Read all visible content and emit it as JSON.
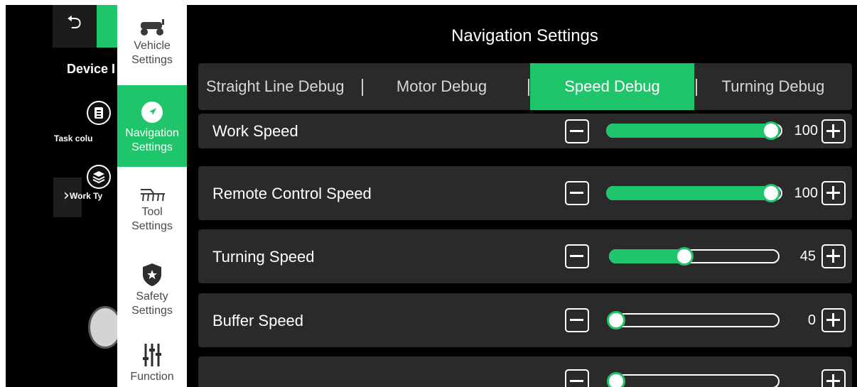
{
  "background_app": {
    "back_icon": "back-arrow-icon",
    "device_title": "Device I",
    "task_label": "Task colu",
    "work_label": "Work Ty",
    "expand_icon": "chevron-right-icon"
  },
  "nav": {
    "items": [
      {
        "label_1": "Vehicle",
        "label_2": "Settings",
        "icon": "tractor-icon",
        "active": false
      },
      {
        "label_1": "Navigation",
        "label_2": "Settings",
        "icon": "navigation-arrow-icon",
        "active": true
      },
      {
        "label_1": "Tool",
        "label_2": "Settings",
        "icon": "harrow-tool-icon",
        "active": false
      },
      {
        "label_1": "Safety",
        "label_2": "Settings",
        "icon": "shield-star-icon",
        "active": false
      },
      {
        "label_1": "Function",
        "label_2": "",
        "icon": "sliders-icon",
        "active": false
      }
    ]
  },
  "main": {
    "title": "Navigation Settings",
    "tabs": [
      {
        "label": "Straight Line Debug",
        "active": false
      },
      {
        "label": "Motor Debug",
        "active": false
      },
      {
        "label": "Speed Debug",
        "active": true
      },
      {
        "label": "Turning Debug",
        "active": false
      }
    ],
    "rows": [
      {
        "label": "Work Speed",
        "value": "100",
        "level": 1.0
      },
      {
        "label": "Remote Control Speed",
        "value": "100",
        "level": 1.0
      },
      {
        "label": "Turning Speed",
        "value": "45",
        "level": 0.45
      },
      {
        "label": "Buffer Speed",
        "value": "0",
        "level": 0.0
      },
      {
        "label": "",
        "value": "",
        "level": 0.0
      }
    ]
  },
  "colors": {
    "accent": "#20c56b",
    "panel": "#2a2a2a",
    "background": "#000000"
  }
}
